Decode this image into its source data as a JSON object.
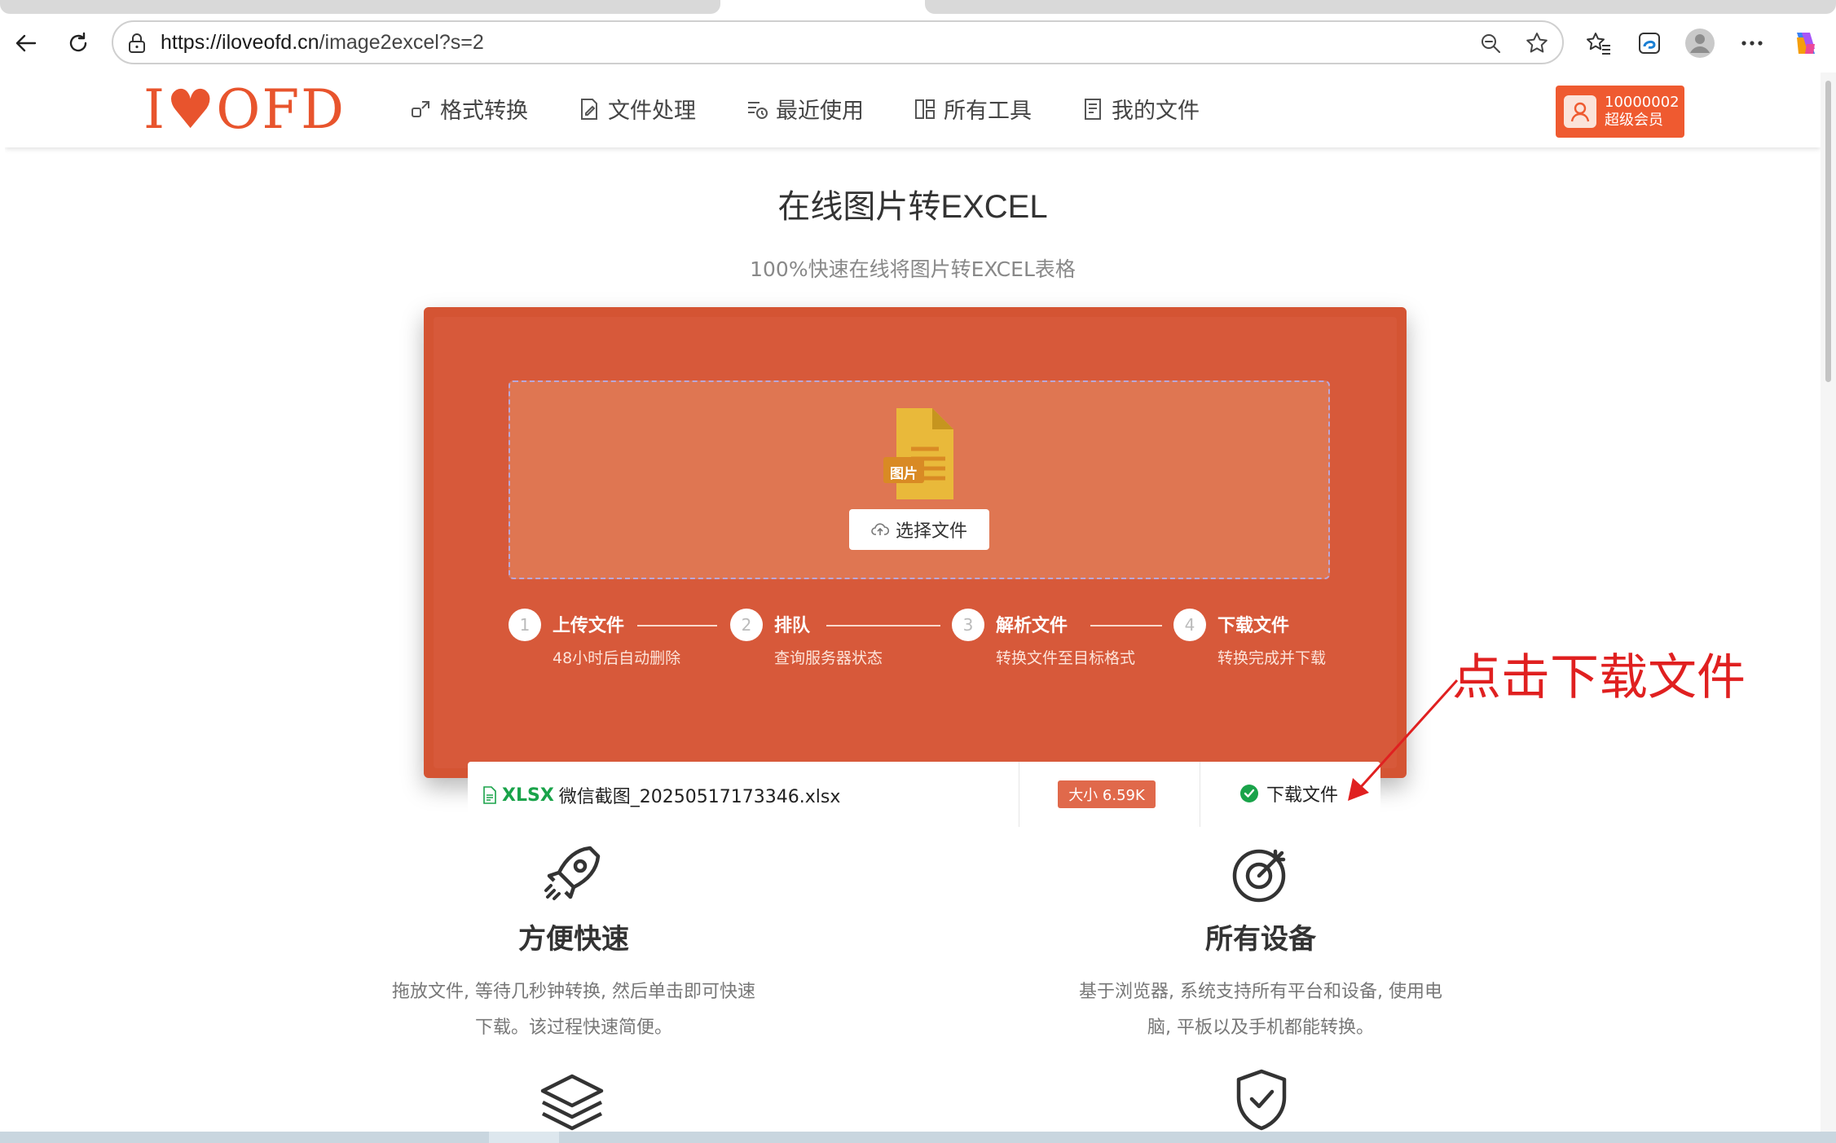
{
  "browser": {
    "url_host": "https://iloveofd.cn",
    "url_path": "/image2excel?s=2"
  },
  "site": {
    "logo": "I♥OFD",
    "nav": [
      {
        "label": "格式转换",
        "icon": "convert-icon"
      },
      {
        "label": "文件处理",
        "icon": "file-edit-icon"
      },
      {
        "label": "最近使用",
        "icon": "recent-icon"
      },
      {
        "label": "所有工具",
        "icon": "tools-icon"
      },
      {
        "label": "我的文件",
        "icon": "my-files-icon"
      }
    ],
    "user": {
      "id": "10000002",
      "level": "超级会员"
    }
  },
  "hero": {
    "title": "在线图片转EXCEL",
    "subtitle": "100%快速在线将图片转EXCEL表格"
  },
  "uploader": {
    "file_icon_label": "图片",
    "choose_button": "选择文件",
    "steps": [
      {
        "num": "1",
        "title": "上传文件",
        "desc": "48小时后自动删除"
      },
      {
        "num": "2",
        "title": "排队",
        "desc": "查询服务器状态"
      },
      {
        "num": "3",
        "title": "解析文件",
        "desc": "转换文件至目标格式"
      },
      {
        "num": "4",
        "title": "下载文件",
        "desc": "转换完成并下载"
      }
    ],
    "result": {
      "type": "XLSX",
      "filename": "微信截图_20250517173346.xlsx",
      "size": "大小 6.59K",
      "download": "下载文件"
    }
  },
  "annotation": {
    "text": "点击下载文件",
    "color": "#e02020"
  },
  "features": [
    {
      "title": "方便快速",
      "desc_line1": "拖放文件, 等待几秒钟转换, 然后单击即可快速",
      "desc_line2": "下载。该过程快速简便。",
      "icon": "rocket-icon"
    },
    {
      "title": "所有设备",
      "desc_line1": "基于浏览器, 系统支持所有平台和设备, 使用电",
      "desc_line2": "脑, 平板以及手机都能转换。",
      "icon": "target-icon"
    }
  ],
  "colors": {
    "brand": "#e8542d",
    "card": "#d45433",
    "success": "#1aa34a"
  }
}
